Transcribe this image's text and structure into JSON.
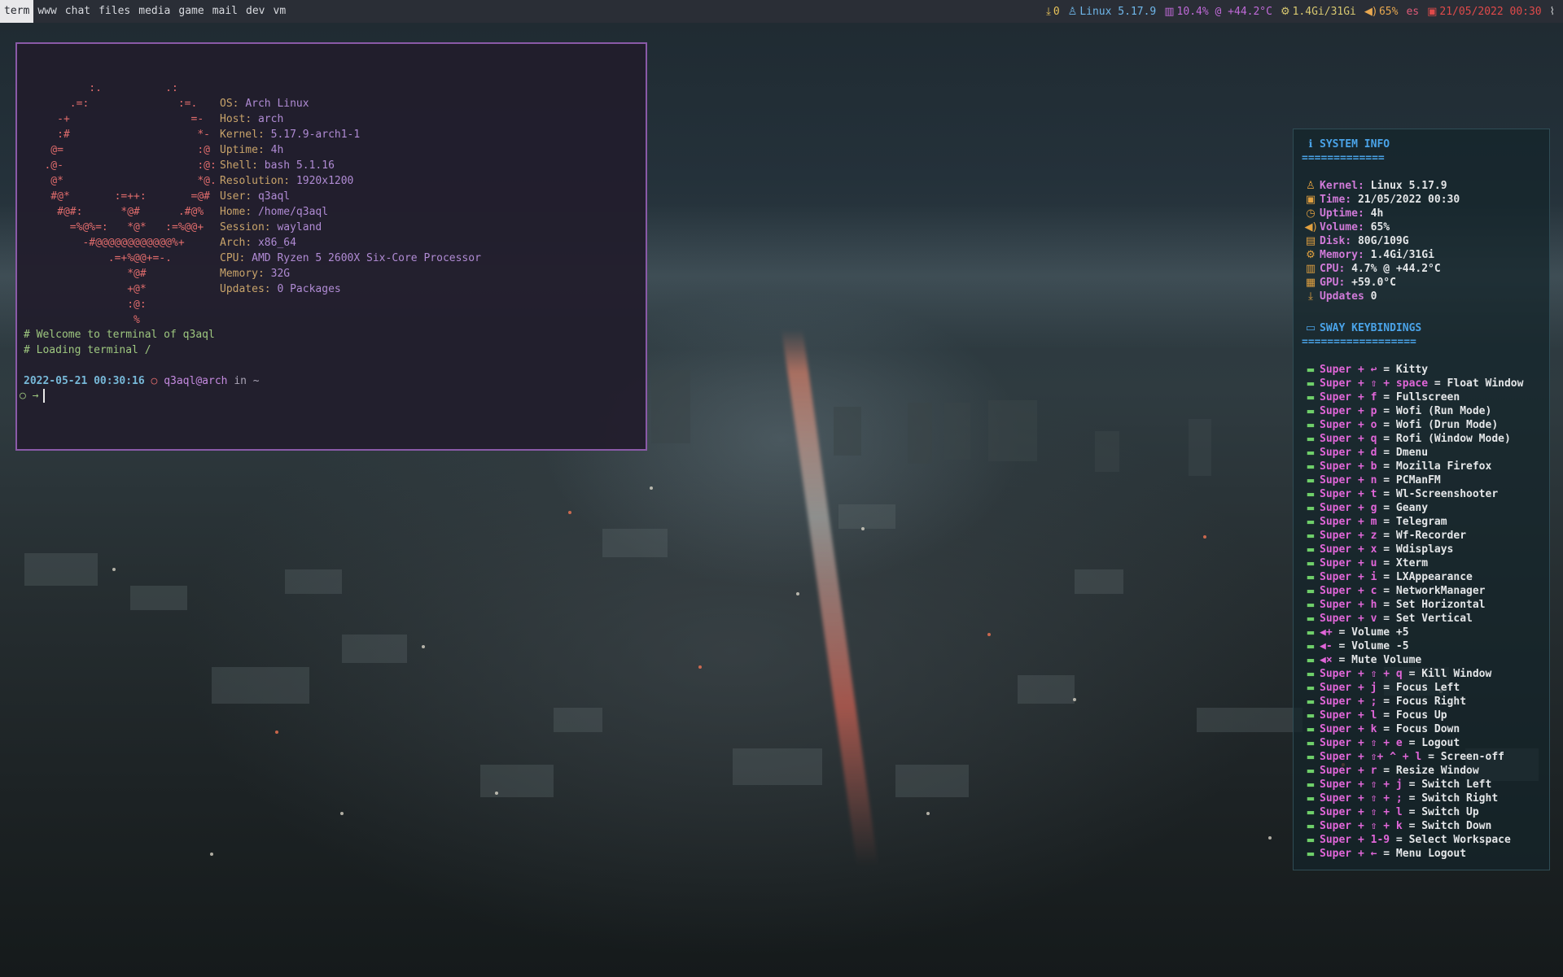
{
  "topbar": {
    "workspaces": [
      "term",
      "www",
      "chat",
      "files",
      "media",
      "game",
      "mail",
      "dev",
      "vm"
    ],
    "active_workspace": "term",
    "updates": "0",
    "kernel": "Linux 5.17.9",
    "cpu": "10.4% @ +44.2°C",
    "memory": "1.4Gi/31Gi",
    "volume": "65%",
    "layout": "es",
    "datetime": "21/05/2022 00:30"
  },
  "terminal": {
    "ascii_art": "\n          :.          .:\n       .=:              :=.\n     -+                   =-\n     :#                    *-\n    @=                     :@\n   .@-                     :@:\n    @*                     *@.\n    #@*       :=++:       =@#\n     #@#:      *@#      .#@%\n       =%@%=:   *@*   :=%@@+\n         -#@@@@@@@@@@@@%+\n             .=+%@@+=-.\n                *@#\n                +@*\n                :@:\n                 %",
    "info": [
      {
        "label": "OS",
        "value": "Arch Linux"
      },
      {
        "label": "Host",
        "value": "arch"
      },
      {
        "label": "Kernel",
        "value": "5.17.9-arch1-1"
      },
      {
        "label": "Uptime",
        "value": "4h"
      },
      {
        "label": "Shell",
        "value": "bash 5.1.16"
      },
      {
        "label": "Resolution",
        "value": "1920x1200"
      },
      {
        "label": "User",
        "value": "q3aql"
      },
      {
        "label": "Home",
        "value": "/home/q3aql"
      },
      {
        "label": "Session",
        "value": "wayland"
      },
      {
        "label": "Arch",
        "value": "x86_64"
      },
      {
        "label": "CPU",
        "value": "AMD Ryzen 5 2600X Six-Core Processor"
      },
      {
        "label": "Memory",
        "value": "32G"
      },
      {
        "label": "Updates",
        "value": "0 Packages"
      }
    ],
    "comments": [
      "# Welcome to terminal of q3aql",
      "# Loading terminal /"
    ],
    "prompt_date": "2022-05-21 00:30:16",
    "prompt_dot": "○",
    "prompt_user": "q3aql@arch",
    "prompt_in": "in",
    "prompt_dir": "~",
    "input_prefix": "○ →"
  },
  "panel": {
    "system_title": "SYSTEM INFO",
    "system_underline": "=============",
    "system": [
      {
        "icon": "linux-icon",
        "glyph": "♙",
        "label": "Kernel:",
        "value": "Linux 5.17.9"
      },
      {
        "icon": "calendar-icon",
        "glyph": "▣",
        "label": "Time:",
        "value": "21/05/2022 00:30"
      },
      {
        "icon": "clock-icon",
        "glyph": "◷",
        "label": "Uptime:",
        "value": "4h"
      },
      {
        "icon": "volume-icon",
        "glyph": "◀)",
        "label": "Volume:",
        "value": "65%"
      },
      {
        "icon": "disk-icon",
        "glyph": "▤",
        "label": "Disk:",
        "value": "80G/109G"
      },
      {
        "icon": "memory-icon",
        "glyph": "⚙",
        "label": "Memory:",
        "value": "1.4Gi/31Gi"
      },
      {
        "icon": "cpu-icon",
        "glyph": "▥",
        "label": "CPU:",
        "value": "4.7% @ +44.2°C"
      },
      {
        "icon": "gpu-icon",
        "glyph": "▦",
        "label": "GPU:",
        "value": "+59.0°C"
      },
      {
        "icon": "download-icon",
        "glyph": "⤓",
        "label": "Updates",
        "value": "0"
      }
    ],
    "keys_title": "SWAY KEYBINDINGS",
    "keys_underline": "==================",
    "keybindings": [
      {
        "key": "Super + ↩",
        "action": "= Kitty"
      },
      {
        "key": "Super + ⇧ + space",
        "action": "= Float Window"
      },
      {
        "key": "Super + f",
        "action": "= Fullscreen"
      },
      {
        "key": "Super + p",
        "action": "= Wofi (Run Mode)"
      },
      {
        "key": "Super + o",
        "action": "= Wofi (Drun Mode)"
      },
      {
        "key": "Super + q",
        "action": "= Rofi (Window Mode)"
      },
      {
        "key": "Super + d",
        "action": "= Dmenu"
      },
      {
        "key": "Super + b",
        "action": "= Mozilla Firefox"
      },
      {
        "key": "Super + n",
        "action": "= PCManFM"
      },
      {
        "key": "Super + t",
        "action": "= Wl-Screenshooter"
      },
      {
        "key": "Super + g",
        "action": "= Geany"
      },
      {
        "key": "Super + m",
        "action": "= Telegram"
      },
      {
        "key": "Super + z",
        "action": "= Wf-Recorder"
      },
      {
        "key": "Super + x",
        "action": "= Wdisplays"
      },
      {
        "key": "Super + u",
        "action": "= Xterm"
      },
      {
        "key": "Super + i",
        "action": "= LXAppearance"
      },
      {
        "key": "Super + c",
        "action": "= NetworkManager"
      },
      {
        "key": "Super + h",
        "action": "= Set Horizontal"
      },
      {
        "key": "Super + v",
        "action": "= Set Vertical"
      },
      {
        "key": "◀+",
        "action": "= Volume +5"
      },
      {
        "key": "◀-",
        "action": "= Volume -5"
      },
      {
        "key": "◀×",
        "action": "= Mute Volume"
      },
      {
        "key": "Super + ⇧ + q",
        "action": "= Kill Window"
      },
      {
        "key": "Super + j",
        "action": "= Focus Left"
      },
      {
        "key": "Super + ;",
        "action": "= Focus Right"
      },
      {
        "key": "Super + l",
        "action": "= Focus Up"
      },
      {
        "key": "Super + k",
        "action": "= Focus Down"
      },
      {
        "key": "Super + ⇧ + e",
        "action": "= Logout"
      },
      {
        "key": "Super + ⇧+  ^ + l",
        "action": "= Screen-off"
      },
      {
        "key": "Super + r",
        "action": "= Resize Window"
      },
      {
        "key": "Super + ⇧ + j",
        "action": "= Switch Left"
      },
      {
        "key": "Super + ⇧ + ;",
        "action": "= Switch Right"
      },
      {
        "key": "Super + ⇧ + l",
        "action": "= Switch Up"
      },
      {
        "key": "Super + ⇧ + k",
        "action": "= Switch Down"
      },
      {
        "key": "Super + 1-9",
        "action": "= Select Workspace"
      },
      {
        "key": "Super + ←",
        "action": "= Menu Logout"
      }
    ]
  },
  "colors": {
    "accent_border": "#8a5aa8",
    "panel_title": "#4aa3e8",
    "key_magenta": "#e066d8",
    "topbar_bg": "#2a2e36"
  }
}
